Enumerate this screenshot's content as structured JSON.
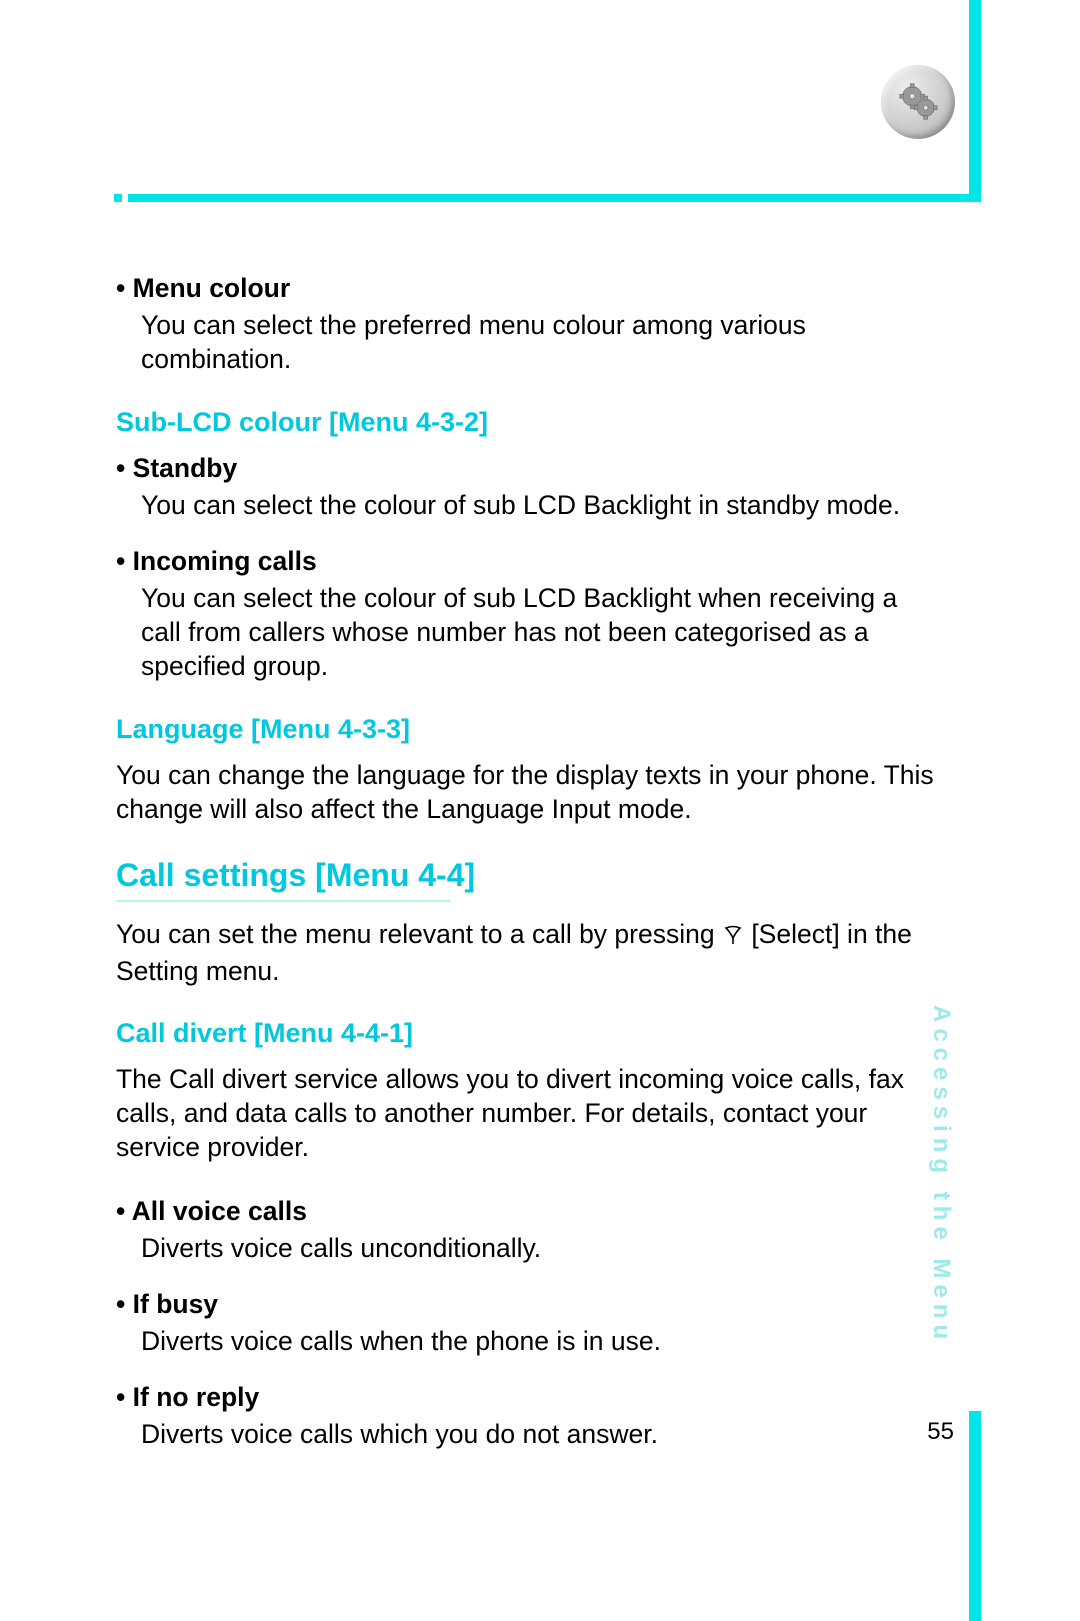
{
  "page_number": "55",
  "side_label": "Accessing the Menu",
  "sections": {
    "menu_colour": {
      "title": "• Menu colour",
      "body": "You can select the preferred menu colour among various combination."
    },
    "sub_lcd": {
      "heading": "Sub-LCD colour [Menu 4-3-2]",
      "standby_title": "• Standby",
      "standby_body": "You can select the colour of sub LCD Backlight in standby mode.",
      "incoming_title": "• Incoming calls",
      "incoming_body": "You can select the colour of sub LCD Backlight when receiving a call from callers whose number has not been categorised as a specified group."
    },
    "language": {
      "heading": "Language [Menu 4-3-3]",
      "body": "You can change the language for the display texts in your phone. This change will also affect the Language Input mode."
    },
    "call_settings": {
      "heading": "Call settings [Menu 4-4]",
      "body_pre": "You can set the menu relevant to a call by pressing ",
      "body_post": " [Select] in the Setting menu."
    },
    "call_divert": {
      "heading": "Call divert [Menu 4-4-1]",
      "body": "The Call divert service allows you to divert incoming voice calls, fax calls, and data calls to another number. For details, contact your service provider.",
      "all_voice_title": "• All voice calls",
      "all_voice_body": "Diverts voice calls unconditionally.",
      "if_busy_title": "• If busy",
      "if_busy_body": "Diverts voice calls when the phone is in use.",
      "if_no_reply_title": "• If no reply",
      "if_no_reply_body": "Diverts voice calls which you do not answer."
    }
  }
}
